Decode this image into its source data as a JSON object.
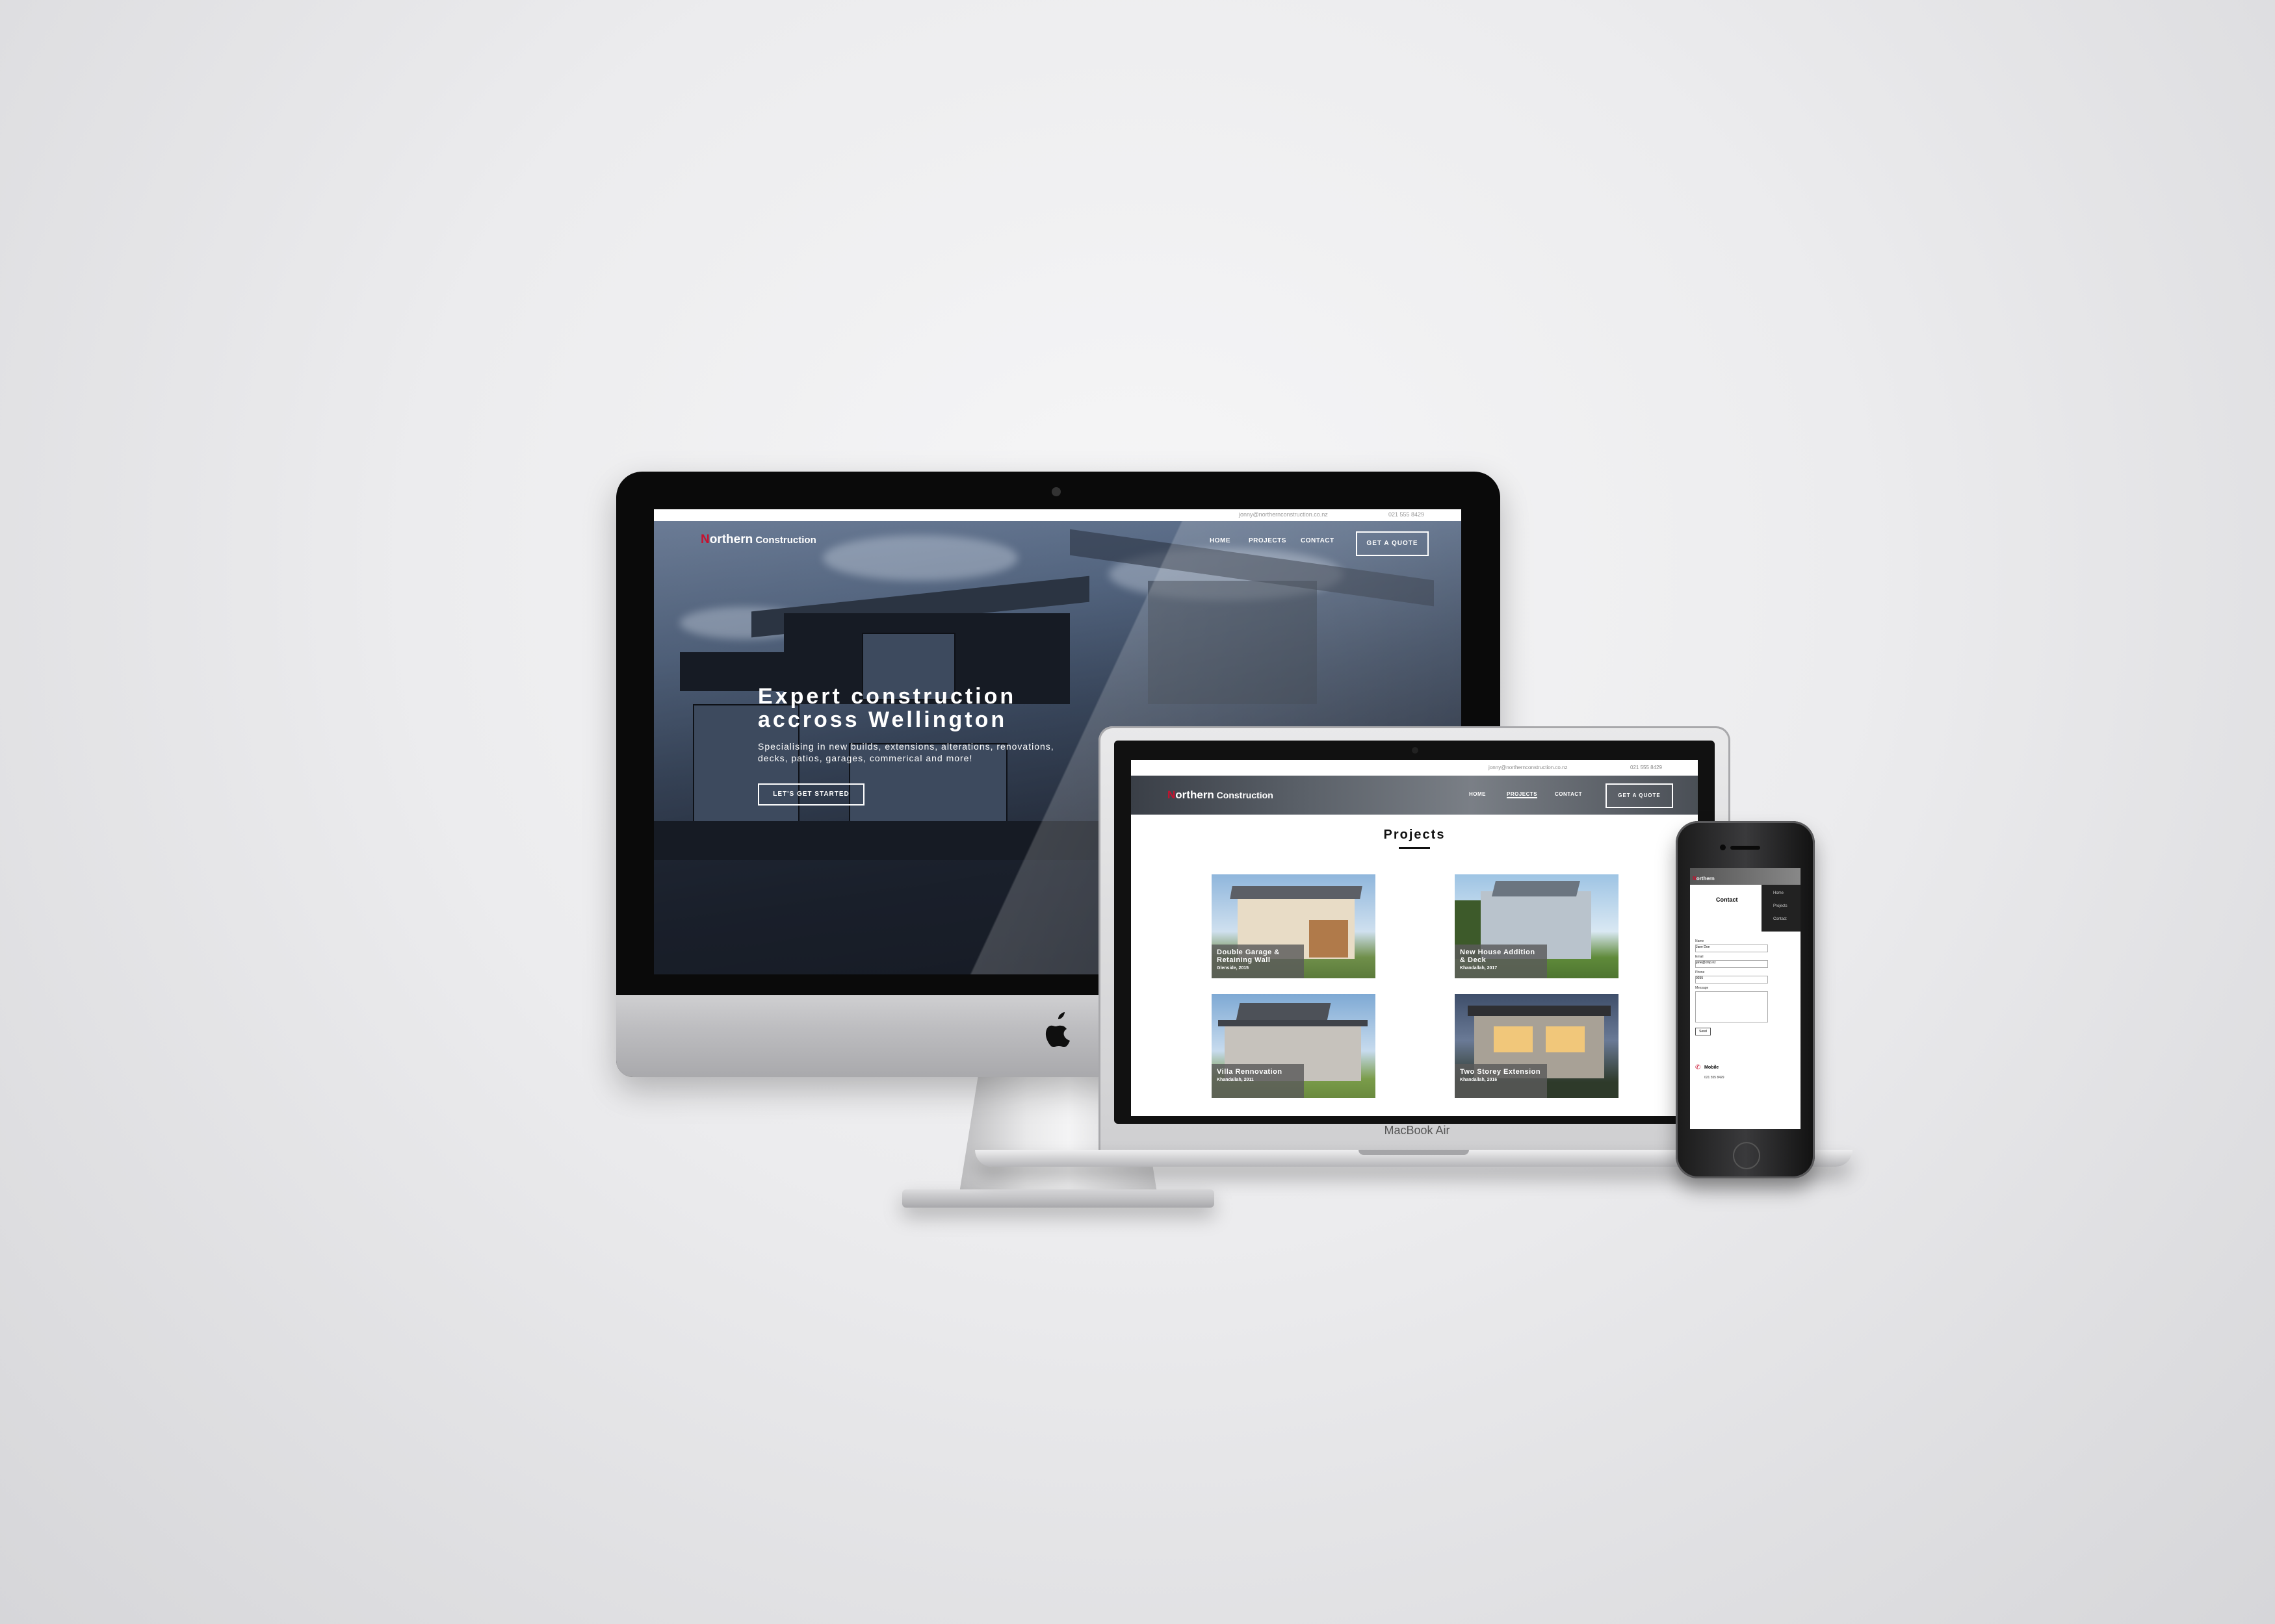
{
  "desktop": {
    "topbar": {
      "email": "jonny@northernconstruction.co.nz",
      "phone": "021 555 8429"
    },
    "logo": {
      "initial": "N",
      "rest_first": "orthern",
      "rest_second": " Construction"
    },
    "nav": [
      "HOME",
      "PROJECTS",
      "CONTACT"
    ],
    "cta_button": "GET A QUOTE",
    "hero": {
      "heading_line1": "Expert construction",
      "heading_line2": "accross Wellington",
      "subtext_line1": "Specialising in new builds, extensions, alterations, renovations,",
      "subtext_line2": "decks, patios, garages, commerical and more!",
      "button": "LET'S GET STARTED"
    }
  },
  "laptop": {
    "brand": "MacBook Air",
    "topbar": {
      "email": "jonny@northernconstruction.co.nz",
      "phone": "021 555 8429"
    },
    "nav": [
      "HOME",
      "PROJECTS",
      "CONTACT"
    ],
    "cta_button": "GET A QUOTE",
    "section_title": "Projects",
    "projects": [
      {
        "title": "Double Garage & Retaining Wall",
        "sub": "Glenside, 2015"
      },
      {
        "title": "New House Addition & Deck",
        "sub": "Khandallah, 2017"
      },
      {
        "title": "Villa Rennovation",
        "sub": "Khandallah, 2011"
      },
      {
        "title": "Two Storey Extension",
        "sub": "Khandallah, 2016"
      }
    ]
  },
  "phone": {
    "menu": [
      "Home",
      "Projects",
      "Contact"
    ],
    "form_title": "Contact",
    "field_labels": [
      "Name",
      "Email",
      "Phone",
      "Message"
    ],
    "field_values": [
      "Jane Doe",
      "jane@xmp.nz",
      "0255",
      ""
    ],
    "submit": "Send",
    "mobile_heading": "Mobile",
    "mobile_number": "021 555 8429"
  }
}
